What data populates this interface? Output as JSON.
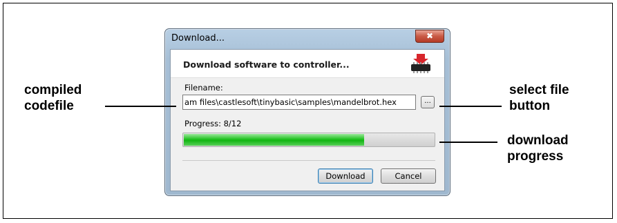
{
  "dialog": {
    "title": "Download...",
    "close_symbol": "✖",
    "header": "Download software to controller...",
    "header_icon": "chip-download-icon",
    "filename_label": "Filename:",
    "filename_value": "am files\\castlesoft\\tinybasic\\samples\\mandelbrot.hex",
    "browse_label": "...",
    "progress_label": "Progress: 8/12",
    "progress_fraction": 0.6667,
    "progress_color": "#1fbf1f",
    "download_button": "Download",
    "cancel_button": "Cancel"
  },
  "annotations": {
    "compiled_codefile": "compiled\ncodefile",
    "select_file_button": "select file\nbutton",
    "download_progress": "download\nprogress"
  }
}
